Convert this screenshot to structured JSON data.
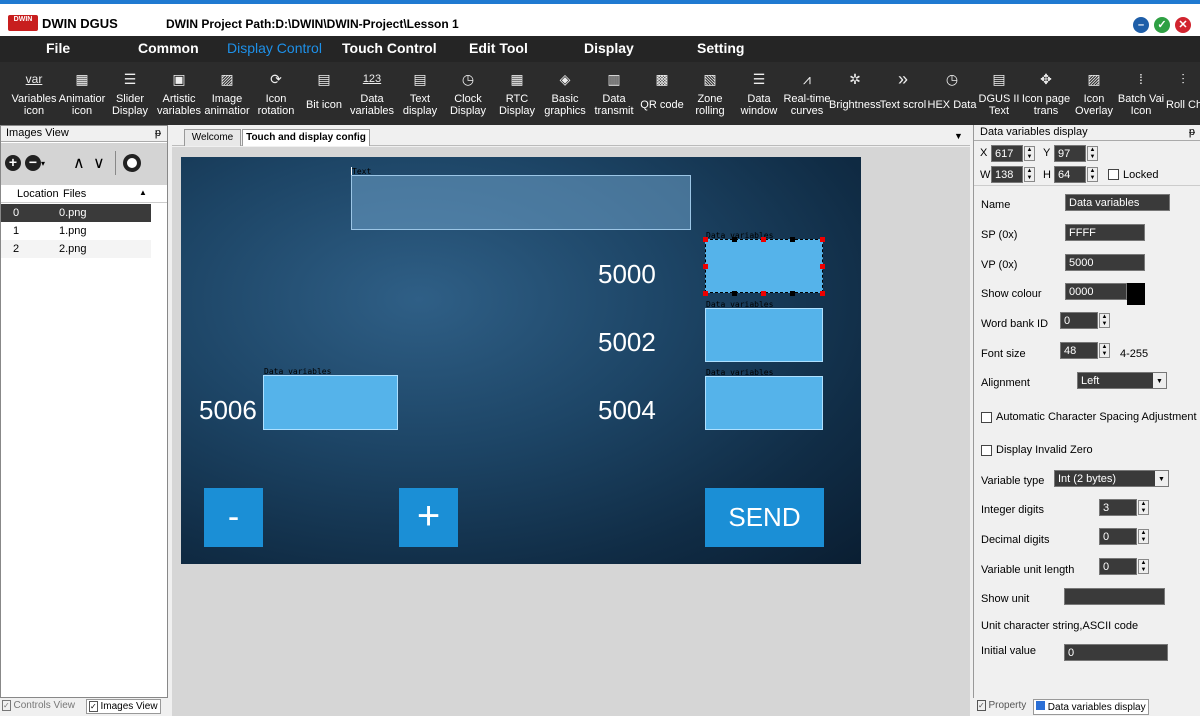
{
  "titlebar": {
    "logo_text": "DWIN",
    "app_name": "DWIN DGUS",
    "project_path": "DWIN Project Path:D:\\DWIN\\DWIN-Project\\Lesson 1"
  },
  "menu": [
    "File",
    "Common",
    "Display Control",
    "Touch Control",
    "Edit Tool",
    "Display",
    "Setting"
  ],
  "toolbar": [
    {
      "label": "Variables\nicon",
      "icon": "var"
    },
    {
      "label": "Animatior\nicon",
      "icon": "film-icon"
    },
    {
      "label": "Slider\nDisplay",
      "icon": "sliders-icon"
    },
    {
      "label": "Artistic\nvariables",
      "icon": "artistic-icon"
    },
    {
      "label": "Image\nanimatior",
      "icon": "image-icon"
    },
    {
      "label": "Icon\nrotation",
      "icon": "rotate-icon"
    },
    {
      "label": "Bit icon",
      "icon": "bit-icon"
    },
    {
      "label": "Data\nvariables",
      "icon": "123"
    },
    {
      "label": "Text\ndisplay",
      "icon": "text-icon"
    },
    {
      "label": "Clock\nDisplay",
      "icon": "clock-icon"
    },
    {
      "label": "RTC\nDisplay",
      "icon": "rtc-icon"
    },
    {
      "label": "Basic\ngraphics",
      "icon": "graphics-icon"
    },
    {
      "label": "Data\ntransmit",
      "icon": "transmit-icon"
    },
    {
      "label": "QR code",
      "icon": "qr-icon"
    },
    {
      "label": "Zone\nrolling",
      "icon": "zone-icon"
    },
    {
      "label": "Data\nwindow",
      "icon": "window-icon"
    },
    {
      "label": "Real-time\ncurves",
      "icon": "curve-icon"
    },
    {
      "label": "Brightness",
      "icon": "brightness-icon"
    },
    {
      "label": "Text scrol",
      "icon": "scroll-icon"
    },
    {
      "label": "HEX Data",
      "icon": "hex-icon"
    },
    {
      "label": "DGUS II\nText",
      "icon": "dgus-text-icon"
    },
    {
      "label": "Icon page\ntrans",
      "icon": "move-icon"
    },
    {
      "label": "Icon\nOverlay",
      "icon": "overlay-icon"
    },
    {
      "label": "Batch Vai\nIcon",
      "icon": "batch-icon"
    },
    {
      "label": "Roll Ch",
      "icon": "roll-icon"
    }
  ],
  "images_view": {
    "title": "Images View",
    "pin": "ᵽ",
    "columns": [
      "Location",
      "Files"
    ],
    "rows": [
      {
        "location": "0",
        "file": "0.png"
      },
      {
        "location": "1",
        "file": "1.png"
      },
      {
        "location": "2",
        "file": "2.png"
      }
    ]
  },
  "left_bottom_tabs": [
    "Controls View",
    "Images View"
  ],
  "tabs": [
    "Welcome",
    "Touch and display config"
  ],
  "canvas": {
    "text_label": "Text",
    "dv_label": "Data variables",
    "numbers": [
      "5000",
      "5002",
      "5004",
      "5006"
    ],
    "minus_label": "-",
    "plus_label": "+",
    "send_label": "SEND"
  },
  "props": {
    "title": "Data variables display",
    "x": "617",
    "y": "97",
    "w": "138",
    "h": "64",
    "locked_label": "Locked",
    "name_label": "Name",
    "name_value": "Data variables",
    "sp_label": "SP (0x)",
    "sp_value": "FFFF",
    "vp_label": "VP (0x)",
    "vp_value": "5000",
    "colour_label": "Show colour",
    "colour_value": "0000",
    "wordbank_label": "Word bank ID",
    "wordbank_value": "0",
    "fontsize_label": "Font size",
    "fontsize_value": "48",
    "fontsize_range": "4-255",
    "align_label": "Alignment",
    "align_value": "Left",
    "auto_spacing_label": "Automatic Character Spacing Adjustment",
    "invalid_zero_label": "Display Invalid Zero",
    "vartype_label": "Variable type",
    "vartype_value": "Int (2 bytes)",
    "intdigits_label": "Integer digits",
    "intdigits_value": "3",
    "decdigits_label": "Decimal digits",
    "decdigits_value": "0",
    "unitlen_label": "Variable unit length",
    "unitlen_value": "0",
    "showunit_label": "Show unit",
    "showunit_value": "",
    "unitstr_label": "Unit character string,ASCII code",
    "initval_label": "Initial value",
    "initval_value": "0"
  },
  "right_bottom_tabs": [
    "Property",
    "Data variables display"
  ],
  "colors": {
    "accent": "#1e90e8",
    "button": "#1b8fd6",
    "dv_fill": "#55b3ea"
  }
}
